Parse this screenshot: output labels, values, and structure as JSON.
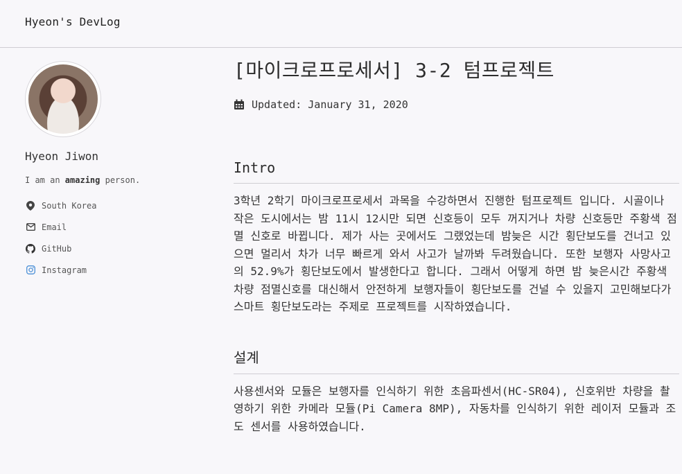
{
  "site": {
    "title": "Hyeon's DevLog"
  },
  "author": {
    "name": "Hyeon Jiwon",
    "bio_prefix": "I am an ",
    "bio_emphasis": "amazing",
    "bio_suffix": " person.",
    "links": [
      {
        "icon": "map-marker-icon",
        "label": "South Korea"
      },
      {
        "icon": "envelope-icon",
        "label": "Email"
      },
      {
        "icon": "github-icon",
        "label": "GitHub"
      },
      {
        "icon": "instagram-icon",
        "label": "Instagram"
      }
    ]
  },
  "post": {
    "title": "[마이크로프로세서] 3-2 텀프로젝트",
    "updated_label": "Updated:",
    "updated_date": "January 31, 2020",
    "sections": [
      {
        "heading": "Intro",
        "body": "3학년 2학기 마이크로프로세서 과목을 수강하면서 진행한 텀프로젝트 입니다. 시골이나 작은 도시에서는 밤 11시 12시만 되면 신호등이 모두 꺼지거나 차량 신호등만 주황색 점멸 신호로 바뀝니다. 제가 사는 곳에서도 그랬었는데 밤늦은 시간 횡단보도를 건너고 있으면 멀리서 차가 너무 빠르게 와서 사고가 날까봐 두려웠습니다. 또한 보행자 사망사고의 52.9%가 횡단보도에서 발생한다고 합니다. 그래서 어떻게 하면 밤 늦은시간 주황색 차량 점멸신호를 대신해서 안전하게 보행자들이 횡단보도를 건널 수 있을지 고민해보다가 스마트 횡단보도라는 주제로 프로젝트를 시작하였습니다."
      },
      {
        "heading": "설계",
        "body": "사용센서와 모듈은 보행자를 인식하기 위한 초음파센서(HC-SR04), 신호위반 차량을 촬영하기 위한 카메라 모듈(Pi Camera 8MP), 자동차를 인식하기 위한 레이저 모듈과 조도 센서를 사용하였습니다."
      }
    ]
  },
  "colors": {
    "background": "#f8f7fa",
    "rule": "#cfcdd3",
    "text": "#333333"
  }
}
